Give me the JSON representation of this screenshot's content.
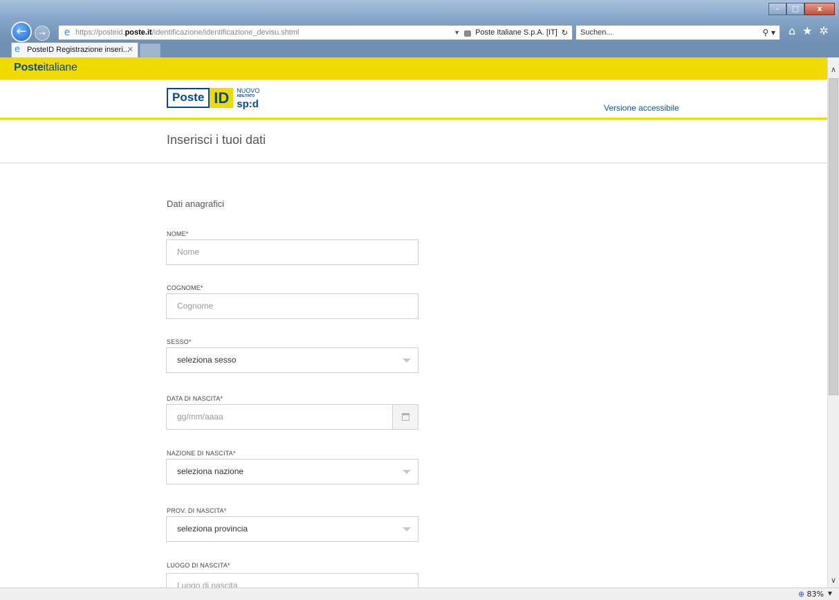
{
  "browser": {
    "url_prefix": "https://",
    "url_sub": "posteid.",
    "url_domain": "poste.it",
    "url_path": "/identificazione/identificazione_devisu.shtml",
    "cert": "Poste Italiane S.p.A. [IT]",
    "search_placeholder": "Suchen...",
    "tab_title": "PosteID Registrazione inseri...",
    "zoom": "83%"
  },
  "page": {
    "brand_bold": "Poste",
    "brand_rest": "italiane",
    "logo_poste": "Poste",
    "logo_id": "ID",
    "logo_nuovo": "NUOVO",
    "logo_abilitato": "ABILITATO",
    "logo_spid": "sp:d",
    "accessible_link": "Versione accessibile",
    "heading": "Inserisci i tuoi dati",
    "section": "Dati anagrafici"
  },
  "form": {
    "nome_label": "NOME*",
    "nome_placeholder": "Nome",
    "cognome_label": "COGNOME*",
    "cognome_placeholder": "Cognome",
    "sesso_label": "SESSO*",
    "sesso_value": "seleziona sesso",
    "data_label": "DATA DI NASCITA*",
    "data_placeholder": "gg/mm/aaaa",
    "nazione_label": "NAZIONE DI NASCITA*",
    "nazione_value": "seleziona nazione",
    "prov_label": "PROV. DI NASCITA*",
    "prov_value": "seleziona provincia",
    "luogo_label": "LUOGO DI NASCITA*",
    "luogo_placeholder": "Luogo di nascita"
  }
}
